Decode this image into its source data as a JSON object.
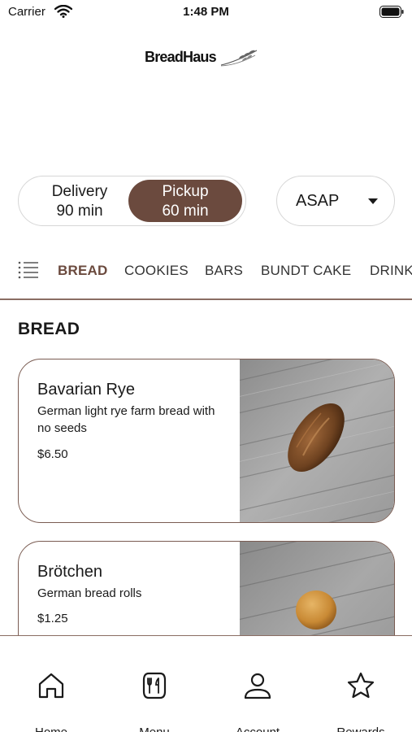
{
  "status_bar": {
    "carrier": "Carrier",
    "time": "1:48 PM"
  },
  "brand": {
    "name": "BreadHaus",
    "accent_color": "#6b4a3e"
  },
  "order_mode": {
    "delivery": {
      "label": "Delivery",
      "time": "90 min",
      "selected": false
    },
    "pickup": {
      "label": "Pickup",
      "time": "60 min",
      "selected": true
    }
  },
  "schedule": {
    "label": "ASAP"
  },
  "categories": [
    {
      "label": "BREAD",
      "active": true
    },
    {
      "label": "COOKIES",
      "active": false
    },
    {
      "label": "BARS",
      "active": false
    },
    {
      "label": "BUNDT CAKE",
      "active": false
    },
    {
      "label": "DRINK",
      "active": false
    }
  ],
  "section": {
    "title": "BREAD"
  },
  "products": [
    {
      "name": "Bavarian Rye",
      "description": "German light rye farm bread with no seeds",
      "price": "$6.50"
    },
    {
      "name": "Brötchen",
      "description": "German bread rolls",
      "price": "$1.25"
    }
  ],
  "bottom_nav": [
    {
      "label": "Home",
      "icon": "home-icon"
    },
    {
      "label": "Menu",
      "icon": "menu-icon"
    },
    {
      "label": "Account",
      "icon": "account-icon"
    },
    {
      "label": "Rewards",
      "icon": "star-icon"
    }
  ]
}
